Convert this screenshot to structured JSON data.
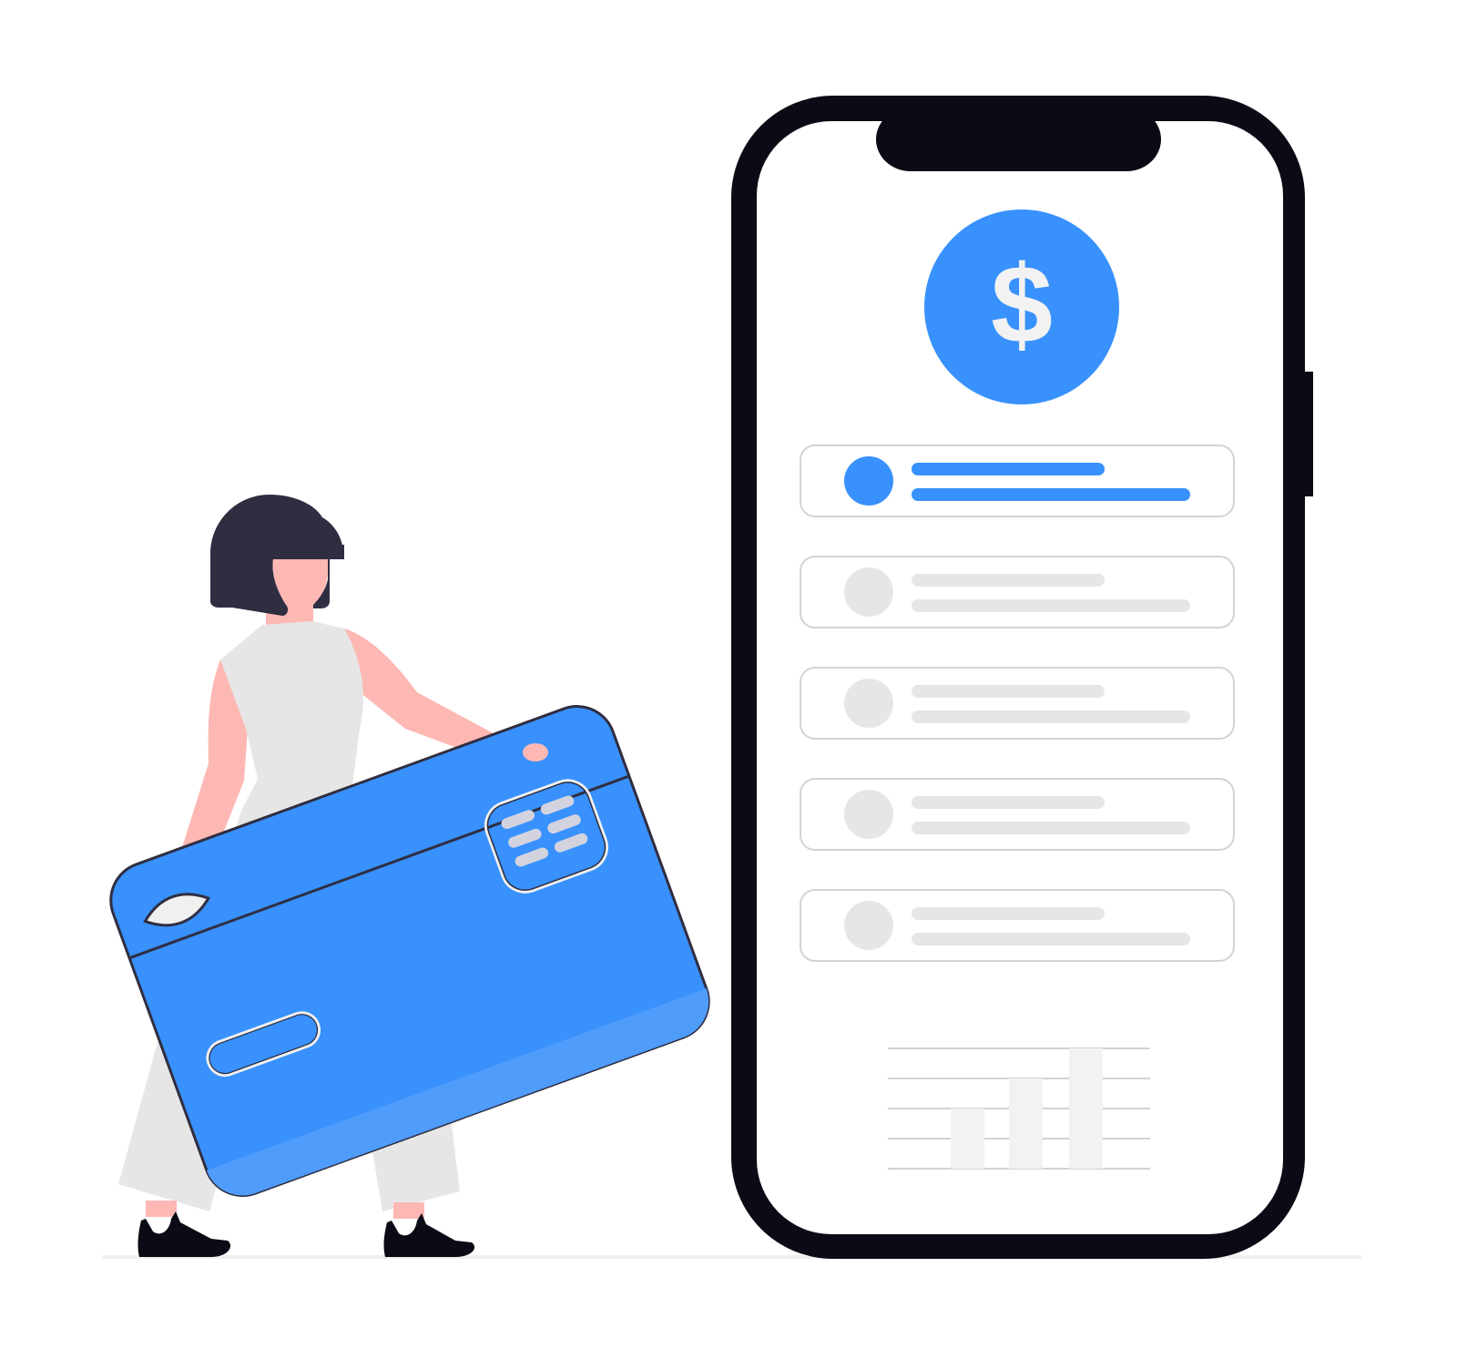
{
  "phone": {
    "currency_symbol": "$",
    "list_items": [
      {
        "state": "active"
      },
      {
        "state": "inactive"
      },
      {
        "state": "inactive"
      },
      {
        "state": "inactive"
      },
      {
        "state": "inactive"
      }
    ],
    "mini_chart": {
      "type": "bar",
      "values": [
        2,
        3,
        4
      ],
      "ylim": [
        0,
        4
      ]
    }
  },
  "colors": {
    "accent": "#3891fc",
    "accent_light": "#4f9cfb",
    "phone_frame": "#0b0b15",
    "placeholder": "#e6e6e6",
    "border": "#d3d3d3",
    "skin": "#fdb8b4",
    "hair": "#2f2e41",
    "clothing": "#e6e6e6",
    "shoes": "#0b0b15"
  },
  "icons": {
    "coin": "dollar-coin-icon",
    "card": "credit-card-icon",
    "chip": "card-chip-icon"
  }
}
